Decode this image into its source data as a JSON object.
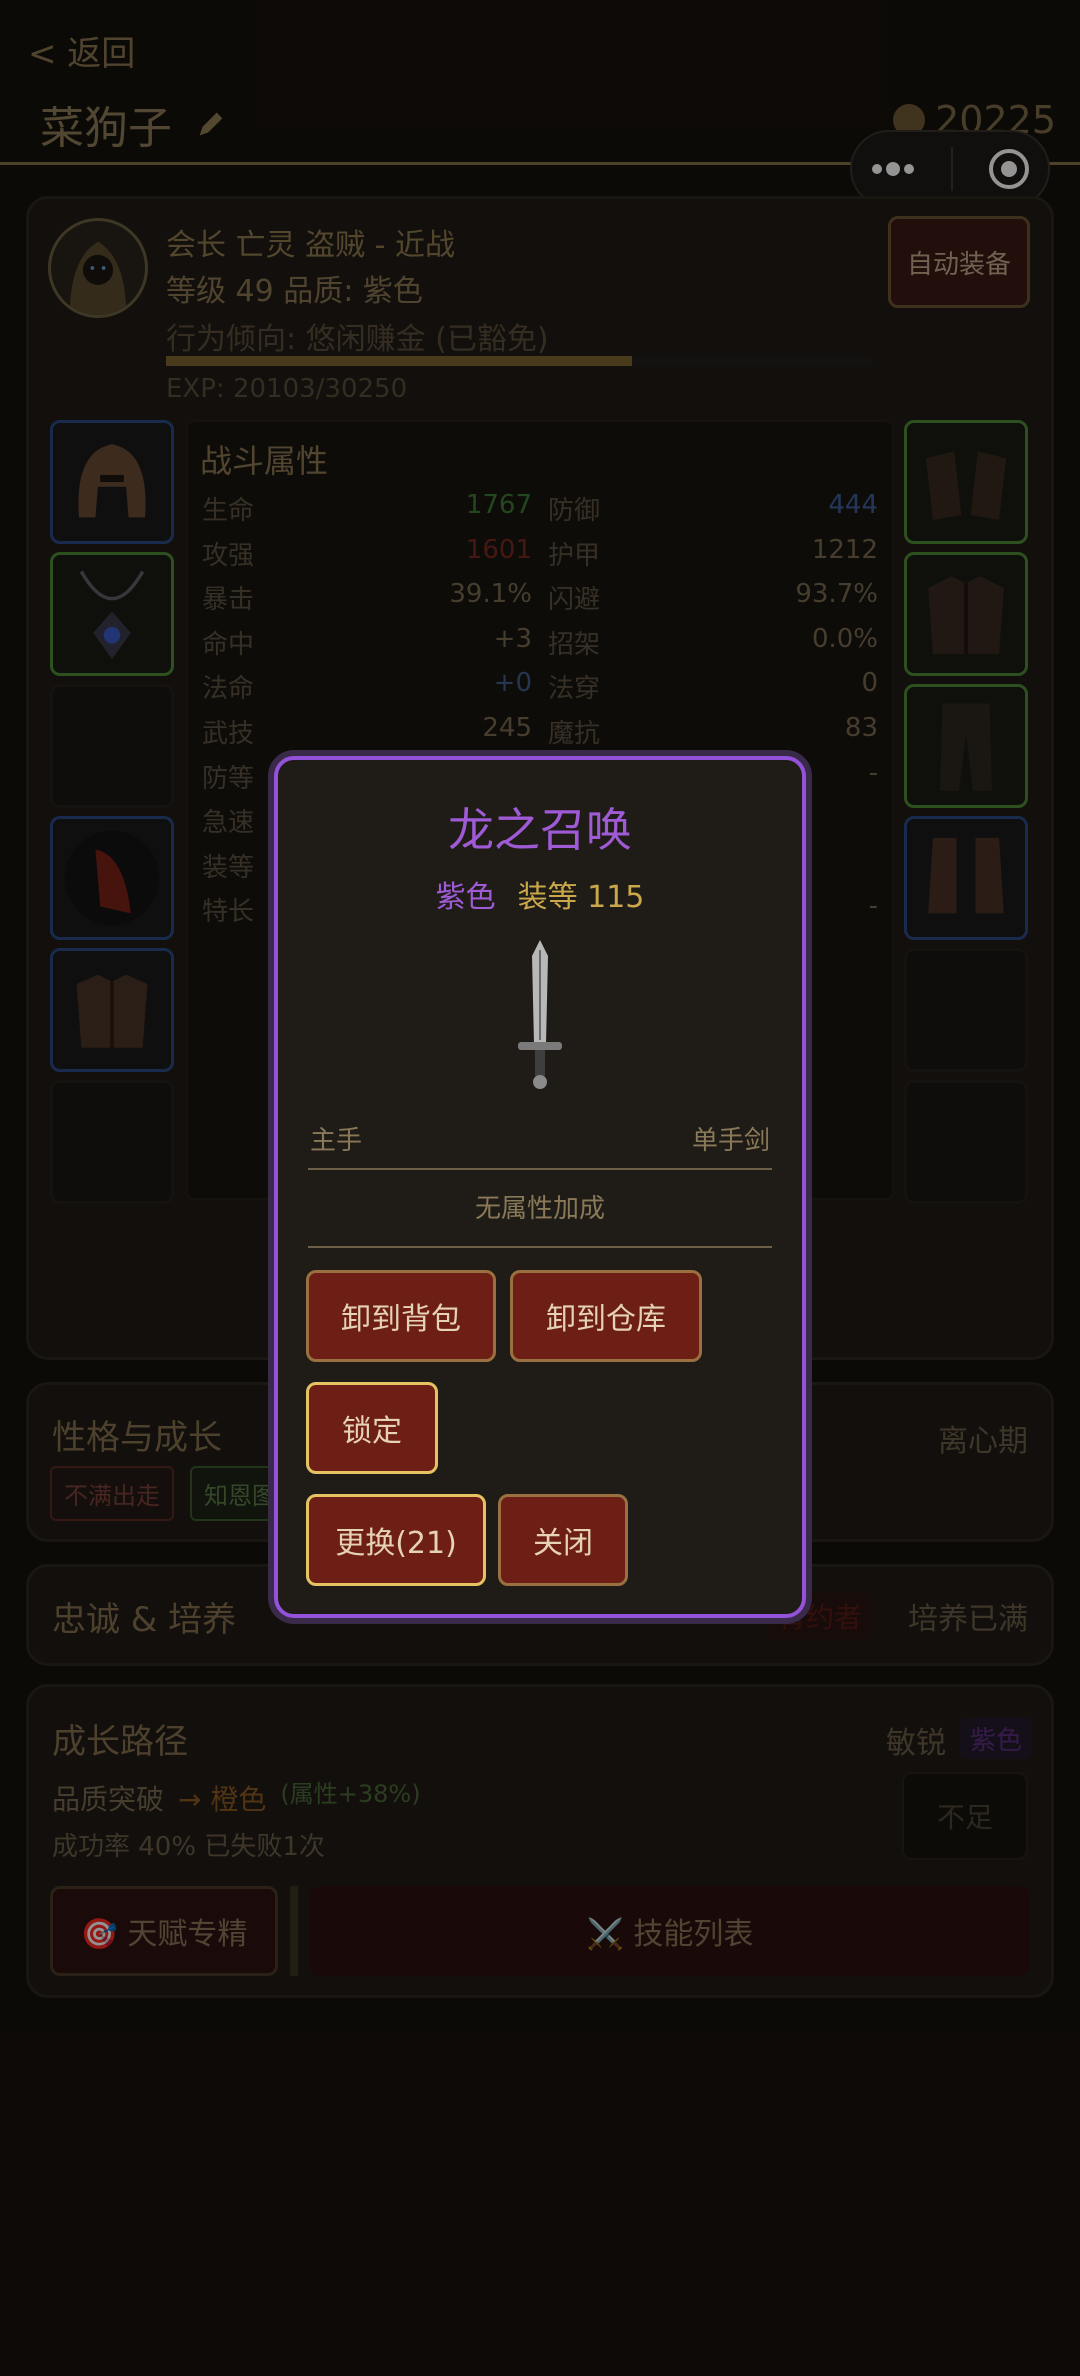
{
  "header": {
    "back": "< 返回",
    "name": "菜狗子",
    "gold": "20225"
  },
  "profile": {
    "line1": "会长 亡灵 盗贼 - 近战",
    "line2": "等级 49  品质: 紫色",
    "line3": "行为倾向: 悠闲赚金 (已豁免)",
    "exp_text": "EXP: 20103/30250",
    "exp_progress": 0.66,
    "auto_equip": "自动装备"
  },
  "stats": {
    "title": "战斗属性",
    "left": [
      {
        "label": "生命",
        "value": "1767",
        "color": "#3d7a34"
      },
      {
        "label": "攻强",
        "value": "1601",
        "color": "#7a2a22"
      },
      {
        "label": "暴击",
        "value": "39.1%",
        "color": "#7a6a50"
      },
      {
        "label": "命中",
        "value": "+3",
        "color": "#7a6a50"
      },
      {
        "label": "法命",
        "value": "+0",
        "color": "#3e5e8a"
      },
      {
        "label": "武技",
        "value": "245",
        "color": "#7a6a50"
      },
      {
        "label": "防等",
        "value": "",
        "color": "#7a6a50"
      },
      {
        "label": "急速",
        "value": "",
        "color": "#7a6a50"
      },
      {
        "label": "装等",
        "value": "",
        "color": "#7a6a50"
      },
      {
        "label": "特长",
        "value": "",
        "color": "#7a6a50"
      }
    ],
    "right": [
      {
        "label": "防御",
        "value": "444",
        "color": "#3e5e9a"
      },
      {
        "label": "护甲",
        "value": "1212",
        "color": "#7a6a50"
      },
      {
        "label": "闪避",
        "value": "93.7%",
        "color": "#7a6a50"
      },
      {
        "label": "招架",
        "value": "0.0%",
        "color": "#7a6a50"
      },
      {
        "label": "法穿",
        "value": "0",
        "color": "#7a6a50"
      },
      {
        "label": "魔抗",
        "value": "83",
        "color": "#7a6a50"
      },
      {
        "label": "",
        "value": "-",
        "color": "#7a6a50"
      },
      {
        "label": "",
        "value": "",
        "color": "#7a6a50"
      },
      {
        "label": "",
        "value": "",
        "color": "#7a6a50"
      },
      {
        "label": "",
        "value": "-",
        "color": "#7a6a50"
      }
    ]
  },
  "personality": {
    "title": "性格与成长",
    "status": "离心期",
    "tags": [
      "不满出走",
      "知恩图报"
    ]
  },
  "loyalty": {
    "title": "忠诚 & 培养",
    "tag": "背约者",
    "status": "培养已满"
  },
  "growth": {
    "title": "成长路径",
    "trait": "敏锐",
    "trait_tag": "紫色",
    "breakthrough_label": "品质突破",
    "breakthrough_target": "→ 橙色",
    "breakthrough_bonus": "(属性+38%)",
    "success_rate": "成功率 40%   已失败1次",
    "insufficient": "不足",
    "talent_btn": "🎯 天赋专精",
    "skills_btn": "⚔️ 技能列表"
  },
  "modal": {
    "title": "龙之召唤",
    "quality": "紫色",
    "ilvl": "装等 115",
    "slot": "主手",
    "type": "单手剑",
    "no_attr": "无属性加成",
    "btn_bag": "卸到背包",
    "btn_warehouse": "卸到仓库",
    "btn_lock": "锁定",
    "btn_replace": "更换(21)",
    "btn_close": "关闭"
  }
}
